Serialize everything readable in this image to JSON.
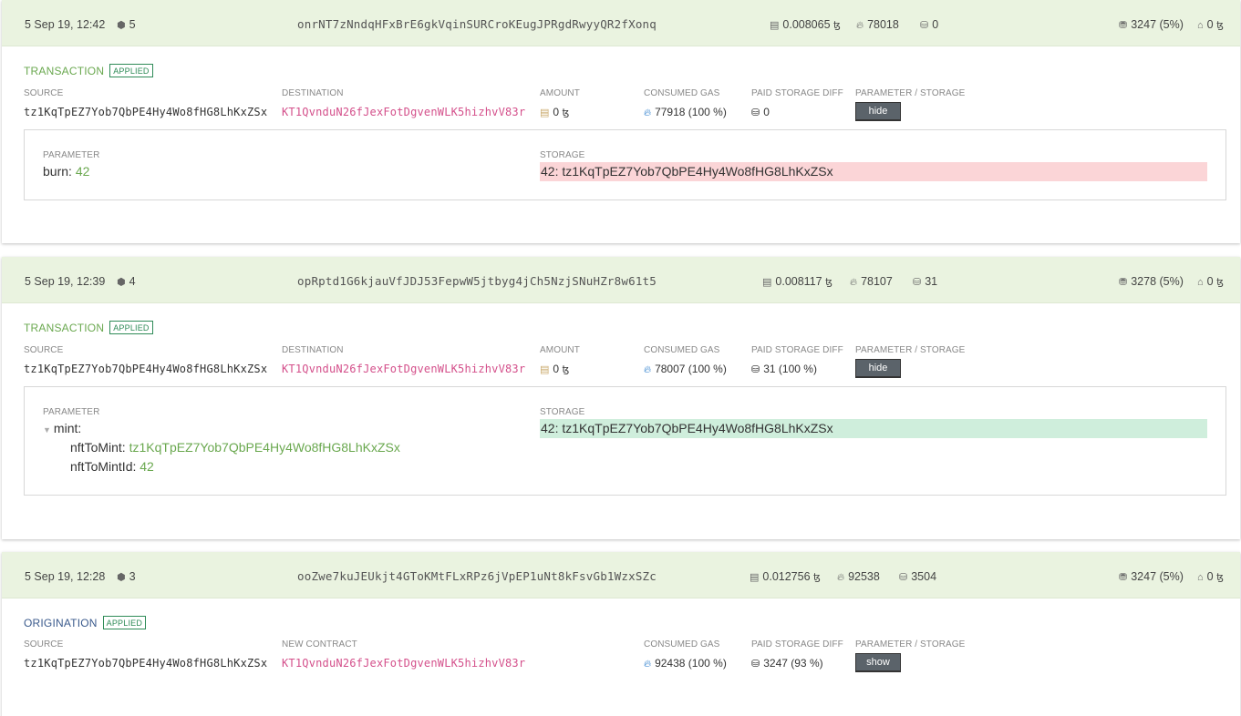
{
  "ops": [
    {
      "header": {
        "time": "5 Sep 19, 12:42",
        "level": "5",
        "hash": "onrNT7zNndqHFxBrE6gkVqinSURCroKEugJPRgdRwyyQR2fXonq",
        "fee": "0.008065",
        "gas": "78018",
        "storage": "0",
        "burn": "3247 (5%)",
        "paid": "0"
      },
      "kind": "TRANSACTION",
      "badge": "APPLIED",
      "labels": {
        "source": "SOURCE",
        "destination": "DESTINATION",
        "amount": "AMOUNT",
        "gas": "CONSUMED GAS",
        "storage": "PAID STORAGE DIFF",
        "param": "PARAMETER / STORAGE"
      },
      "source": "tz1KqTpEZ7Yob7QbPE4Hy4Wo8fHG8LhKxZSx",
      "destination": "KT1QvnduN26fJexFotDgvenWLK5hizhvV83r",
      "amount": "0",
      "consumed_gas": "77918",
      "consumed_gas_pct": "(100 %)",
      "storage_diff": "0",
      "storage_diff_pct": "",
      "button": "hide",
      "detail": {
        "param_label": "PARAMETER",
        "storage_label": "STORAGE",
        "param_key": "burn:",
        "param_value": "42",
        "storage_key": "42:",
        "storage_value": "tz1KqTpEZ7Yob7QbPE4Hy4Wo8fHG8LhKxZSx"
      }
    },
    {
      "header": {
        "time": "5 Sep 19, 12:39",
        "level": "4",
        "hash": "opRptd1G6kjauVfJDJ53FepwW5jtbyg4jCh5NzjSNuHZr8w61t5",
        "fee": "0.008117",
        "gas": "78107",
        "storage": "31",
        "burn": "3278 (5%)",
        "paid": "0"
      },
      "kind": "TRANSACTION",
      "badge": "APPLIED",
      "labels": {
        "source": "SOURCE",
        "destination": "DESTINATION",
        "amount": "AMOUNT",
        "gas": "CONSUMED GAS",
        "storage": "PAID STORAGE DIFF",
        "param": "PARAMETER / STORAGE"
      },
      "source": "tz1KqTpEZ7Yob7QbPE4Hy4Wo8fHG8LhKxZSx",
      "destination": "KT1QvnduN26fJexFotDgvenWLK5hizhvV83r",
      "amount": "0",
      "consumed_gas": "78007",
      "consumed_gas_pct": "(100 %)",
      "storage_diff": "31",
      "storage_diff_pct": "(100 %)",
      "button": "hide",
      "detail": {
        "param_label": "PARAMETER",
        "storage_label": "STORAGE",
        "param_key": "mint:",
        "param_fields": [
          {
            "key": "nftToMint:",
            "value": "tz1KqTpEZ7Yob7QbPE4Hy4Wo8fHG8LhKxZSx"
          },
          {
            "key": "nftToMintId:",
            "value": "42"
          }
        ],
        "storage_key": "42:",
        "storage_value": "tz1KqTpEZ7Yob7QbPE4Hy4Wo8fHG8LhKxZSx"
      }
    },
    {
      "header": {
        "time": "5 Sep 19, 12:28",
        "level": "3",
        "hash": "ooZwe7kuJEUkjt4GToKMtFLxRPz6jVpEP1uNt8kFsvGb1WzxSZc",
        "fee": "0.012756",
        "gas": "92538",
        "storage": "3504",
        "burn": "3247 (5%)",
        "paid": "0"
      },
      "kind": "ORIGINATION",
      "badge": "APPLIED",
      "labels": {
        "source": "SOURCE",
        "new_contract": "NEW CONTRACT",
        "gas": "CONSUMED GAS",
        "storage": "PAID STORAGE DIFF",
        "param": "PARAMETER / STORAGE"
      },
      "source": "tz1KqTpEZ7Yob7QbPE4Hy4Wo8fHG8LhKxZSx",
      "new_contract": "KT1QvnduN26fJexFotDgvenWLK5hizhvV83r",
      "consumed_gas": "92438",
      "consumed_gas_pct": "(100 %)",
      "storage_diff": "3247",
      "storage_diff_pct": "(93 %)",
      "button": "show"
    }
  ],
  "icons": {
    "block": "cube-icon",
    "fee": "receipt-icon",
    "gas": "flame-icon",
    "storage": "coins-icon",
    "burn": "database-icon",
    "paid": "bank-icon"
  },
  "currency": "ꜩ",
  "colors": {
    "header_bg": "#eaf3e0",
    "destination": "#d4508b",
    "applied": "#2e8b57",
    "storage_removed": "#fbd5d7",
    "storage_added": "#cfeedc"
  }
}
